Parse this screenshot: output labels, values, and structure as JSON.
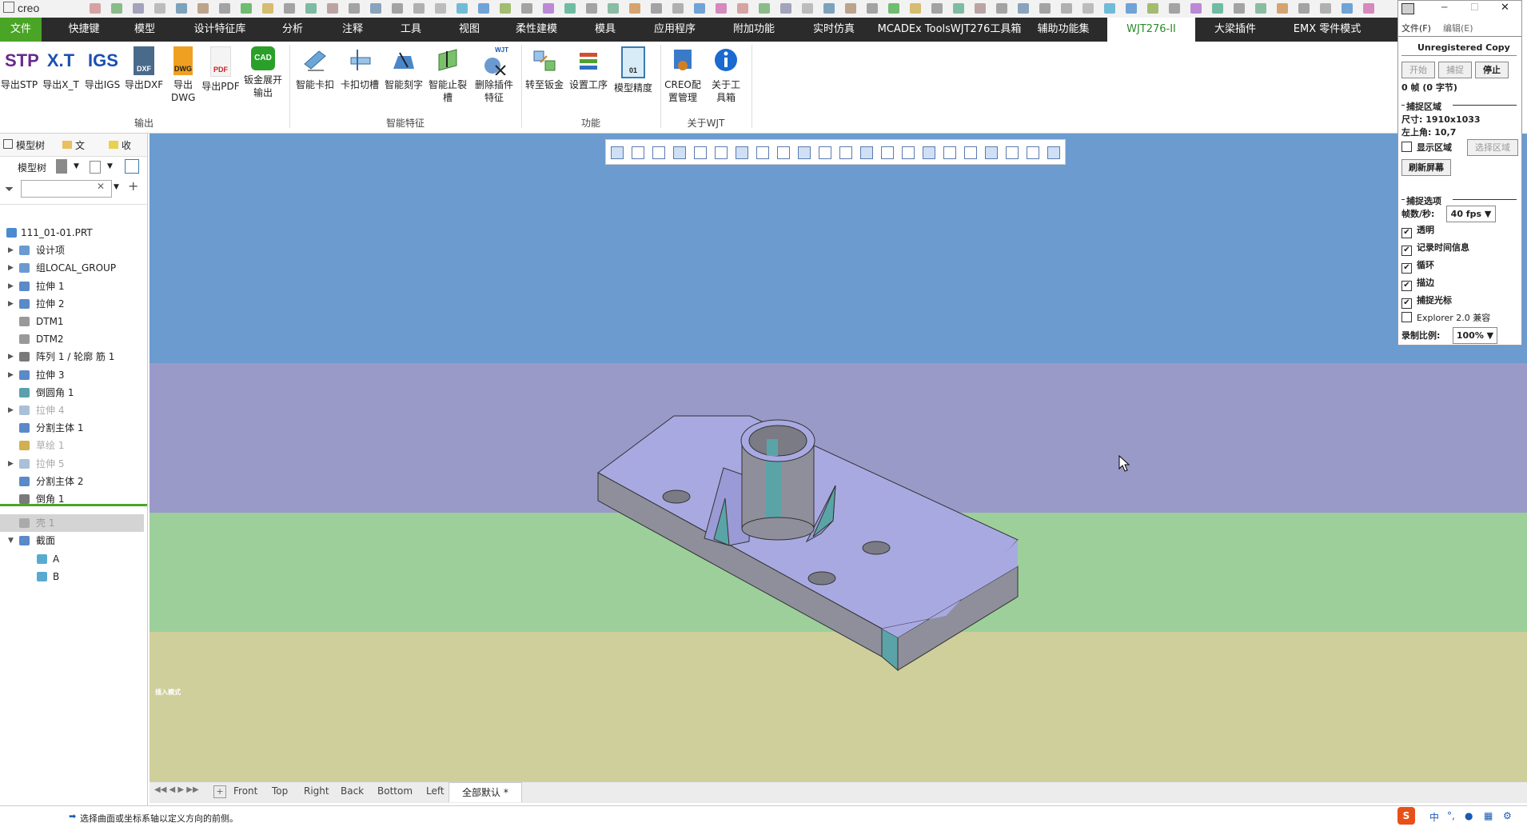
{
  "app": {
    "logo": "creo"
  },
  "ribbon_tabs": [
    {
      "label": "文件"
    },
    {
      "label": "快捷键"
    },
    {
      "label": "模型"
    },
    {
      "label": "设计特征库"
    },
    {
      "label": "分析"
    },
    {
      "label": "注释"
    },
    {
      "label": "工具"
    },
    {
      "label": "视图"
    },
    {
      "label": "柔性建模"
    },
    {
      "label": "模具"
    },
    {
      "label": "应用程序"
    },
    {
      "label": "附加功能"
    },
    {
      "label": "实时仿真"
    },
    {
      "label": "MCADEx ToolsWJT276工具箱"
    },
    {
      "label": "辅助功能集"
    },
    {
      "label": "WJT276-II"
    },
    {
      "label": "大梁插件"
    },
    {
      "label": "EMX 零件模式"
    }
  ],
  "ribbon": {
    "export_buttons": [
      {
        "icon_text": "STP",
        "label": "导出STP"
      },
      {
        "icon_text": "X.T",
        "label": "导出X_T"
      },
      {
        "icon_text": "IGS",
        "label": "导出IGS"
      },
      {
        "icon_text": "DXF",
        "label": "导出DXF"
      },
      {
        "icon_text": "DWG",
        "label": "导出DWG"
      },
      {
        "icon_text": "PDF",
        "label": "导出PDF"
      },
      {
        "icon_text": "CAD",
        "label": "钣金展开输出"
      }
    ],
    "smart_buttons": [
      {
        "label": "智能卡扣"
      },
      {
        "label": "卡扣切槽"
      },
      {
        "label": "智能刻字"
      },
      {
        "label": "智能止裂槽"
      },
      {
        "icon_text": "WJT",
        "label": "删除插件特征"
      }
    ],
    "func_buttons": [
      {
        "label": "转至钣金"
      },
      {
        "label": "设置工序"
      },
      {
        "icon_text": "01",
        "label": "模型精度"
      }
    ],
    "about_buttons": [
      {
        "label": "CREO配置管理"
      },
      {
        "label": "关于工具箱"
      }
    ],
    "groups": {
      "export": "输出",
      "smart": "智能特征",
      "func": "功能",
      "about": "关于WJT"
    }
  },
  "panel": {
    "tabs": [
      "模型树",
      "文",
      "收"
    ],
    "toolbar_label": "模型树",
    "search_placeholder": "",
    "tree": [
      {
        "label": "111_01-01.PRT",
        "arrow": "",
        "state": "normal"
      },
      {
        "label": "设计项",
        "arrow": "▶",
        "state": "normal"
      },
      {
        "label": "组LOCAL_GROUP",
        "arrow": "▶",
        "state": "normal"
      },
      {
        "label": "拉伸 1",
        "arrow": "▶",
        "state": "normal"
      },
      {
        "label": "拉伸 2",
        "arrow": "▶",
        "state": "normal"
      },
      {
        "label": "DTM1",
        "arrow": "",
        "state": "normal"
      },
      {
        "label": "DTM2",
        "arrow": "",
        "state": "normal"
      },
      {
        "label": "阵列 1 / 轮廓 筋 1",
        "arrow": "▶",
        "state": "normal"
      },
      {
        "label": "拉伸 3",
        "arrow": "▶",
        "state": "normal"
      },
      {
        "label": "倒圆角 1",
        "arrow": "",
        "state": "normal"
      },
      {
        "label": "拉伸 4",
        "arrow": "▶",
        "state": "dim"
      },
      {
        "label": "分割主体 1",
        "arrow": "",
        "state": "normal"
      },
      {
        "label": "草绘 1",
        "arrow": "",
        "state": "dim"
      },
      {
        "label": "拉伸 5",
        "arrow": "▶",
        "state": "dim"
      },
      {
        "label": "分割主体 2",
        "arrow": "",
        "state": "normal"
      },
      {
        "label": "倒角 1",
        "arrow": "",
        "state": "normal"
      },
      {
        "label": "壳 1",
        "arrow": "",
        "state": "selected"
      },
      {
        "label": "截面",
        "arrow": "▼",
        "state": "normal"
      },
      {
        "label": "A",
        "arrow": "",
        "state": "sub"
      },
      {
        "label": "B",
        "arrow": "",
        "state": "sub"
      }
    ]
  },
  "viewport": {
    "watermark": "插入模式"
  },
  "view_tabs": [
    "Front",
    "Top",
    "Right",
    "Back",
    "Bottom",
    "Left",
    "全部默认 *"
  ],
  "status": {
    "message": "选择曲面或坐标系轴以定义方向的前侧。"
  },
  "capture": {
    "menu_file": "文件(F)",
    "menu_edit": "编辑(E)",
    "unregistered": "Unregistered Copy",
    "btn_start": "开始",
    "btn_capture": "捕捉",
    "btn_stop": "停止",
    "frames": "0 帧 (0 字节)",
    "area_title": "捕捉区域",
    "size": "尺寸: 1910x1033",
    "topleft": "左上角: 10,7",
    "show_area": "显示区域",
    "select_area": "选择区域",
    "refresh": "刷新屏幕",
    "options_title": "捕捉选项",
    "fps_label": "帧数/秒:",
    "fps_value": "40 fps",
    "options": [
      {
        "label": "透明",
        "checked": true
      },
      {
        "label": "记录时间信息",
        "checked": true
      },
      {
        "label": "循环",
        "checked": true
      },
      {
        "label": "描边",
        "checked": true
      },
      {
        "label": "捕捉光标",
        "checked": true
      },
      {
        "label": "Explorer 2.0 兼容",
        "checked": false
      }
    ],
    "scale_label": "录制比例:",
    "scale_value": "100%"
  },
  "colors": {
    "band1": "#6b9bcf",
    "band2": "#9a9ac9",
    "band3": "#9dcf9a",
    "band4": "#cfcf9c",
    "part_top": "#a9a9e2",
    "part_side": "#8f8f9b",
    "ribbon_dark": "#2b2b2b",
    "file_green": "#4aa526"
  }
}
